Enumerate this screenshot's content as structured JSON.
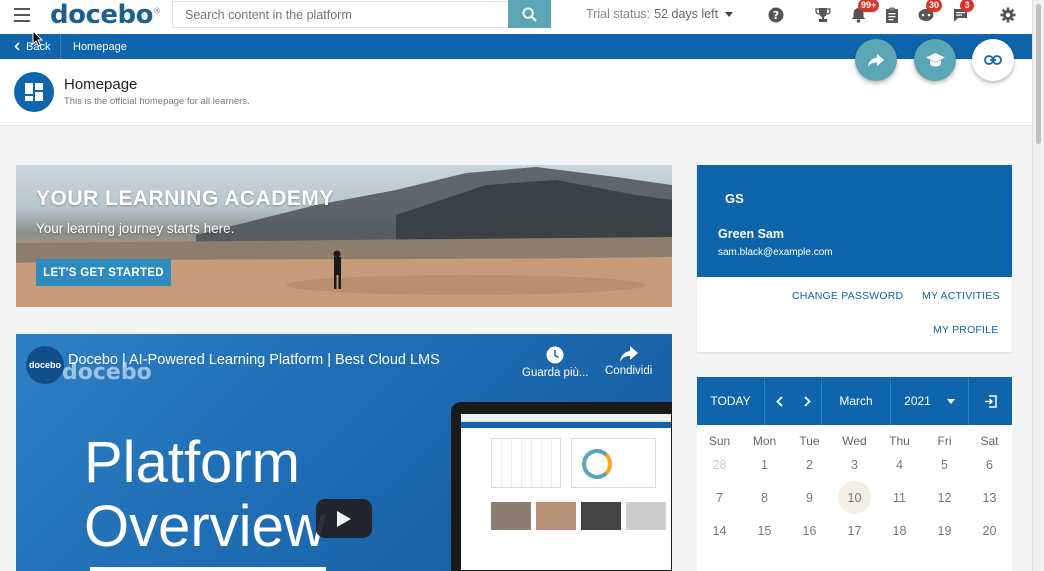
{
  "topbar": {
    "logo": "docebo",
    "search_placeholder": "Search content in the platform",
    "trial_label": "Trial status:",
    "trial_days": "52 days left",
    "icons": [
      "help-icon",
      "trophy-icon",
      "bell-icon",
      "clipboard-icon",
      "coach-icon",
      "chat-icon",
      "gear-icon"
    ],
    "badges": {
      "notifications": "99+",
      "coach": "30",
      "chat": "3"
    }
  },
  "breadcrumb": {
    "back": "Back",
    "current": "Homepage"
  },
  "header": {
    "title": "Homepage",
    "subtitle": "This is the official homepage for all learners."
  },
  "hero": {
    "title": "YOUR LEARNING ACADEMY",
    "subtitle": "Your learning journey starts here.",
    "cta": "LET'S GET STARTED"
  },
  "video": {
    "channel": "docebo",
    "title": "Docebo | AI-Powered Learning Platform | Best Cloud LMS",
    "watermark": "docebo",
    "watch_later": "Guarda più...",
    "share": "Condividi",
    "line1": "Platform",
    "line2": "Overview"
  },
  "profile": {
    "initials": "GS",
    "name": "Green Sam",
    "email": "sam.black@example.com",
    "change_password": "CHANGE PASSWORD",
    "my_activities": "MY ACTIVITIES",
    "my_profile": "MY PROFILE"
  },
  "calendar": {
    "today_label": "TODAY",
    "month": "March",
    "year": "2021",
    "weekdays": [
      "Sun",
      "Mon",
      "Tue",
      "Wed",
      "Thu",
      "Fri",
      "Sat"
    ],
    "weeks": [
      [
        "28",
        "1",
        "2",
        "3",
        "4",
        "5",
        "6"
      ],
      [
        "7",
        "8",
        "9",
        "10",
        "11",
        "12",
        "13"
      ],
      [
        "14",
        "15",
        "16",
        "17",
        "18",
        "19",
        "20"
      ]
    ],
    "today_day": "10"
  },
  "colors": {
    "primary": "#0f65ab",
    "teal": "#5ba6b5",
    "badge": "#d9342b"
  }
}
